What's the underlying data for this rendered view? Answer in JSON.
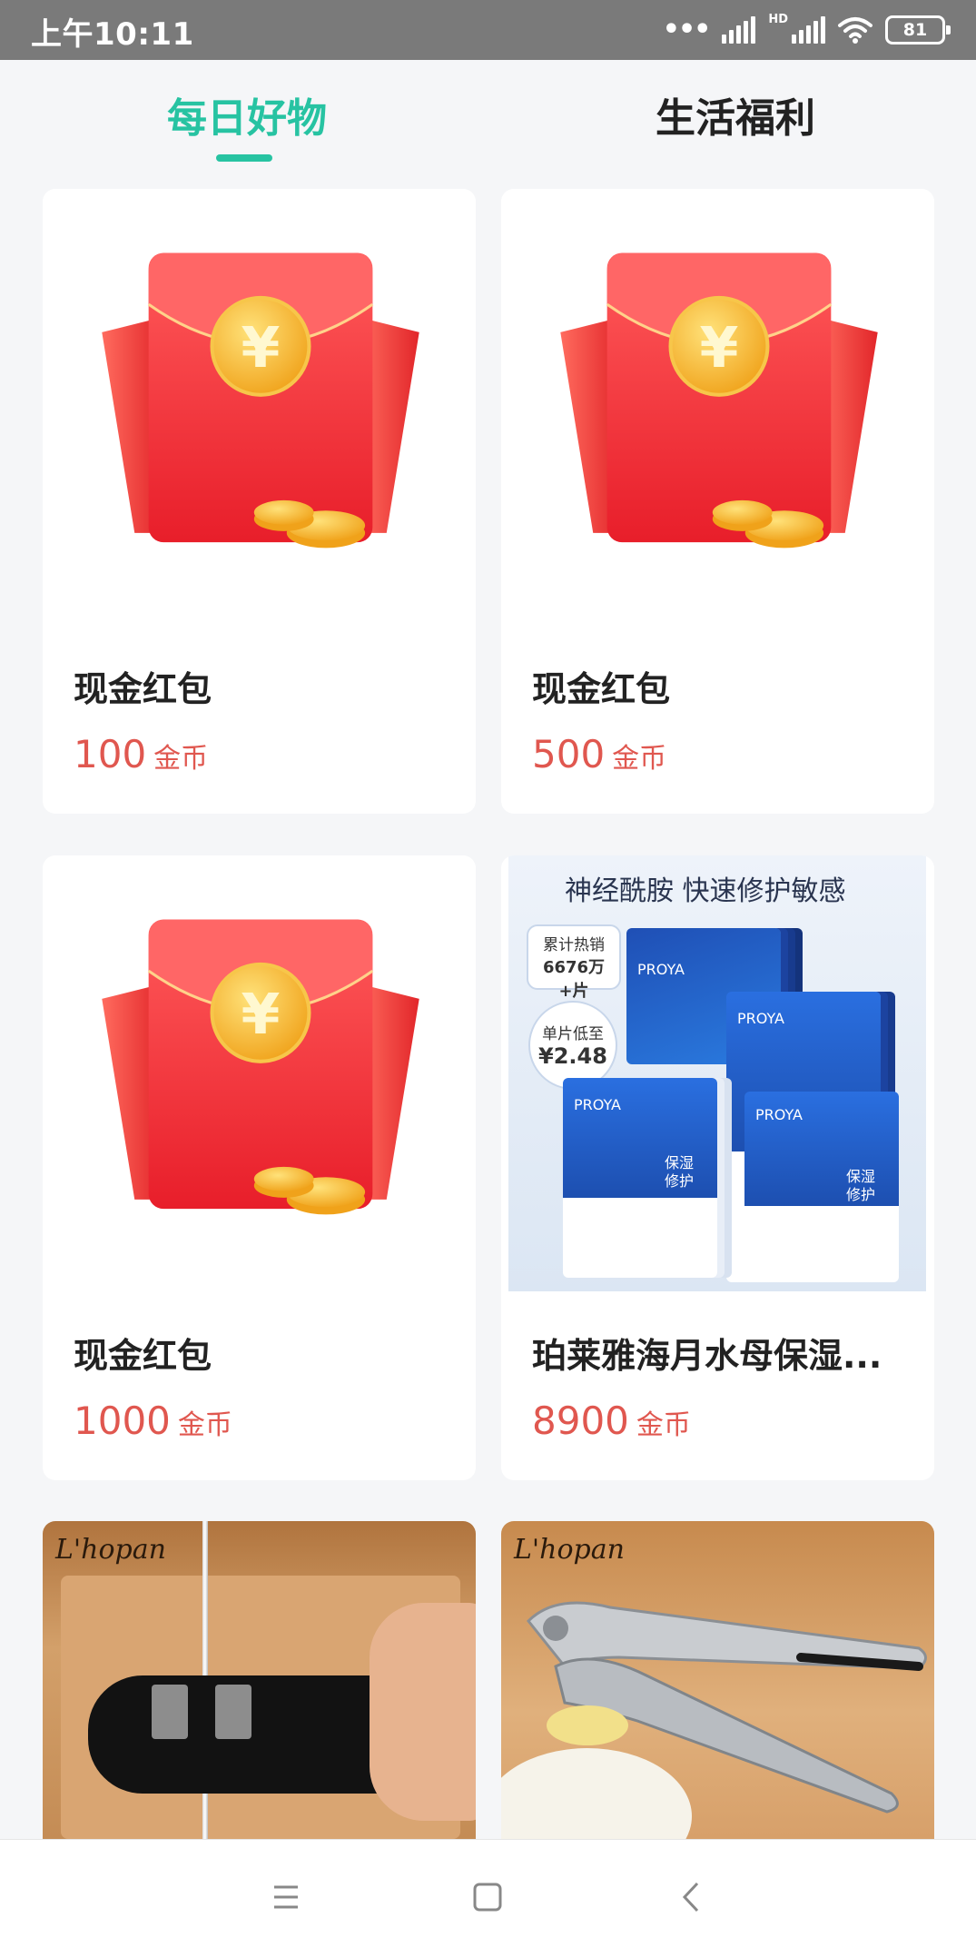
{
  "status_bar": {
    "time": "上午10:11",
    "network": "HD",
    "battery": "81"
  },
  "tabs": [
    {
      "label": "每日好物",
      "active": true
    },
    {
      "label": "生活福利",
      "active": false
    }
  ],
  "products": [
    {
      "title": "现金红包",
      "price": "100",
      "unit": "金币",
      "image": "red-packet"
    },
    {
      "title": "现金红包",
      "price": "500",
      "unit": "金币",
      "image": "red-packet"
    },
    {
      "title": "现金红包",
      "price": "1000",
      "unit": "金币",
      "image": "red-packet"
    },
    {
      "title": "珀莱雅海月水母保湿...",
      "price": "8900",
      "unit": "金币",
      "image": "face-mask",
      "image_text": {
        "headline": "神经酰胺 快速修护敏感",
        "badge1_line1": "累计热销",
        "badge1_line2": "6676万+片",
        "badge2_line1": "单片低至",
        "badge2_line2": "¥2.48",
        "brand": "PROYA",
        "tag": "保湿",
        "tag2": "修护"
      }
    },
    {
      "title": "",
      "price": "",
      "unit": "",
      "image": "knife-sharpener",
      "image_text": {
        "brand": "L'hopan"
      }
    },
    {
      "title": "",
      "price": "",
      "unit": "",
      "image": "garlic-press",
      "image_text": {
        "brand": "L'hopan"
      }
    }
  ],
  "nav": {
    "menu": "menu-icon",
    "home": "home-icon",
    "back": "back-icon"
  },
  "colors": {
    "accent": "#27c3a2",
    "price": "#e0574f",
    "status_bar": "#7a7a7a"
  }
}
